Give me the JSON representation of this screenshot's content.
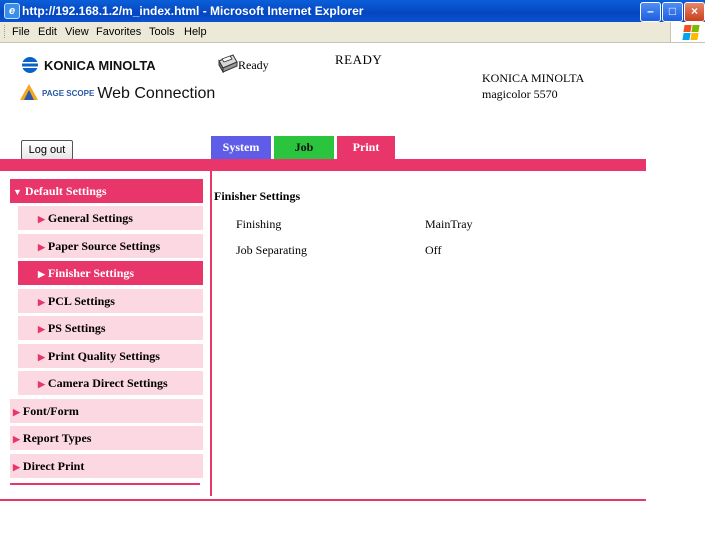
{
  "window": {
    "title": "http://192.168.1.2/m_index.html - Microsoft Internet Explorer",
    "ie_icon": "ie-icon",
    "buttons": [
      "minimize-icon",
      "maximize-icon",
      "close-icon"
    ]
  },
  "menubar": {
    "items": [
      "File",
      "Edit",
      "View",
      "Favorites",
      "Tools",
      "Help"
    ]
  },
  "header": {
    "brand_logo": "KONICA MINOLTA",
    "pagescope_logo_small": "PAGE SCOPE",
    "pagescope_logo": "Web Connection",
    "status_small": "Ready",
    "status_big": "READY",
    "device_vendor": "KONICA MINOLTA",
    "device_model": "magicolor 5570"
  },
  "toolbar": {
    "logout_label": "Log out"
  },
  "tabs": [
    {
      "label": "System",
      "color": "#5f5ce8"
    },
    {
      "label": "Job",
      "color": "#2bc43e"
    },
    {
      "label": "Print",
      "color": "#e8356a"
    }
  ],
  "sidebar": {
    "items": [
      {
        "label": "Default Settings",
        "level": 0,
        "state": "open"
      },
      {
        "label": "General Settings",
        "level": 1,
        "state": "normal"
      },
      {
        "label": "Paper Source Settings",
        "level": 1,
        "state": "normal"
      },
      {
        "label": "Finisher Settings",
        "level": 1,
        "state": "active"
      },
      {
        "label": "PCL Settings",
        "level": 1,
        "state": "normal"
      },
      {
        "label": "PS Settings",
        "level": 1,
        "state": "normal"
      },
      {
        "label": "Print Quality Settings",
        "level": 1,
        "state": "normal"
      },
      {
        "label": "Camera Direct Settings",
        "level": 1,
        "state": "normal"
      },
      {
        "label": "Font/Form",
        "level": 0,
        "state": "normal"
      },
      {
        "label": "Report Types",
        "level": 0,
        "state": "normal"
      },
      {
        "label": "Direct Print",
        "level": 0,
        "state": "normal"
      }
    ]
  },
  "main": {
    "title": "Finisher Settings",
    "rows": [
      {
        "label": "Finishing",
        "value": "MainTray"
      },
      {
        "label": "Job Separating",
        "value": "Off"
      }
    ]
  },
  "colors": {
    "accent": "#e8356a",
    "accent_light": "#fcd8e2",
    "titlebar": "#0546c0"
  }
}
